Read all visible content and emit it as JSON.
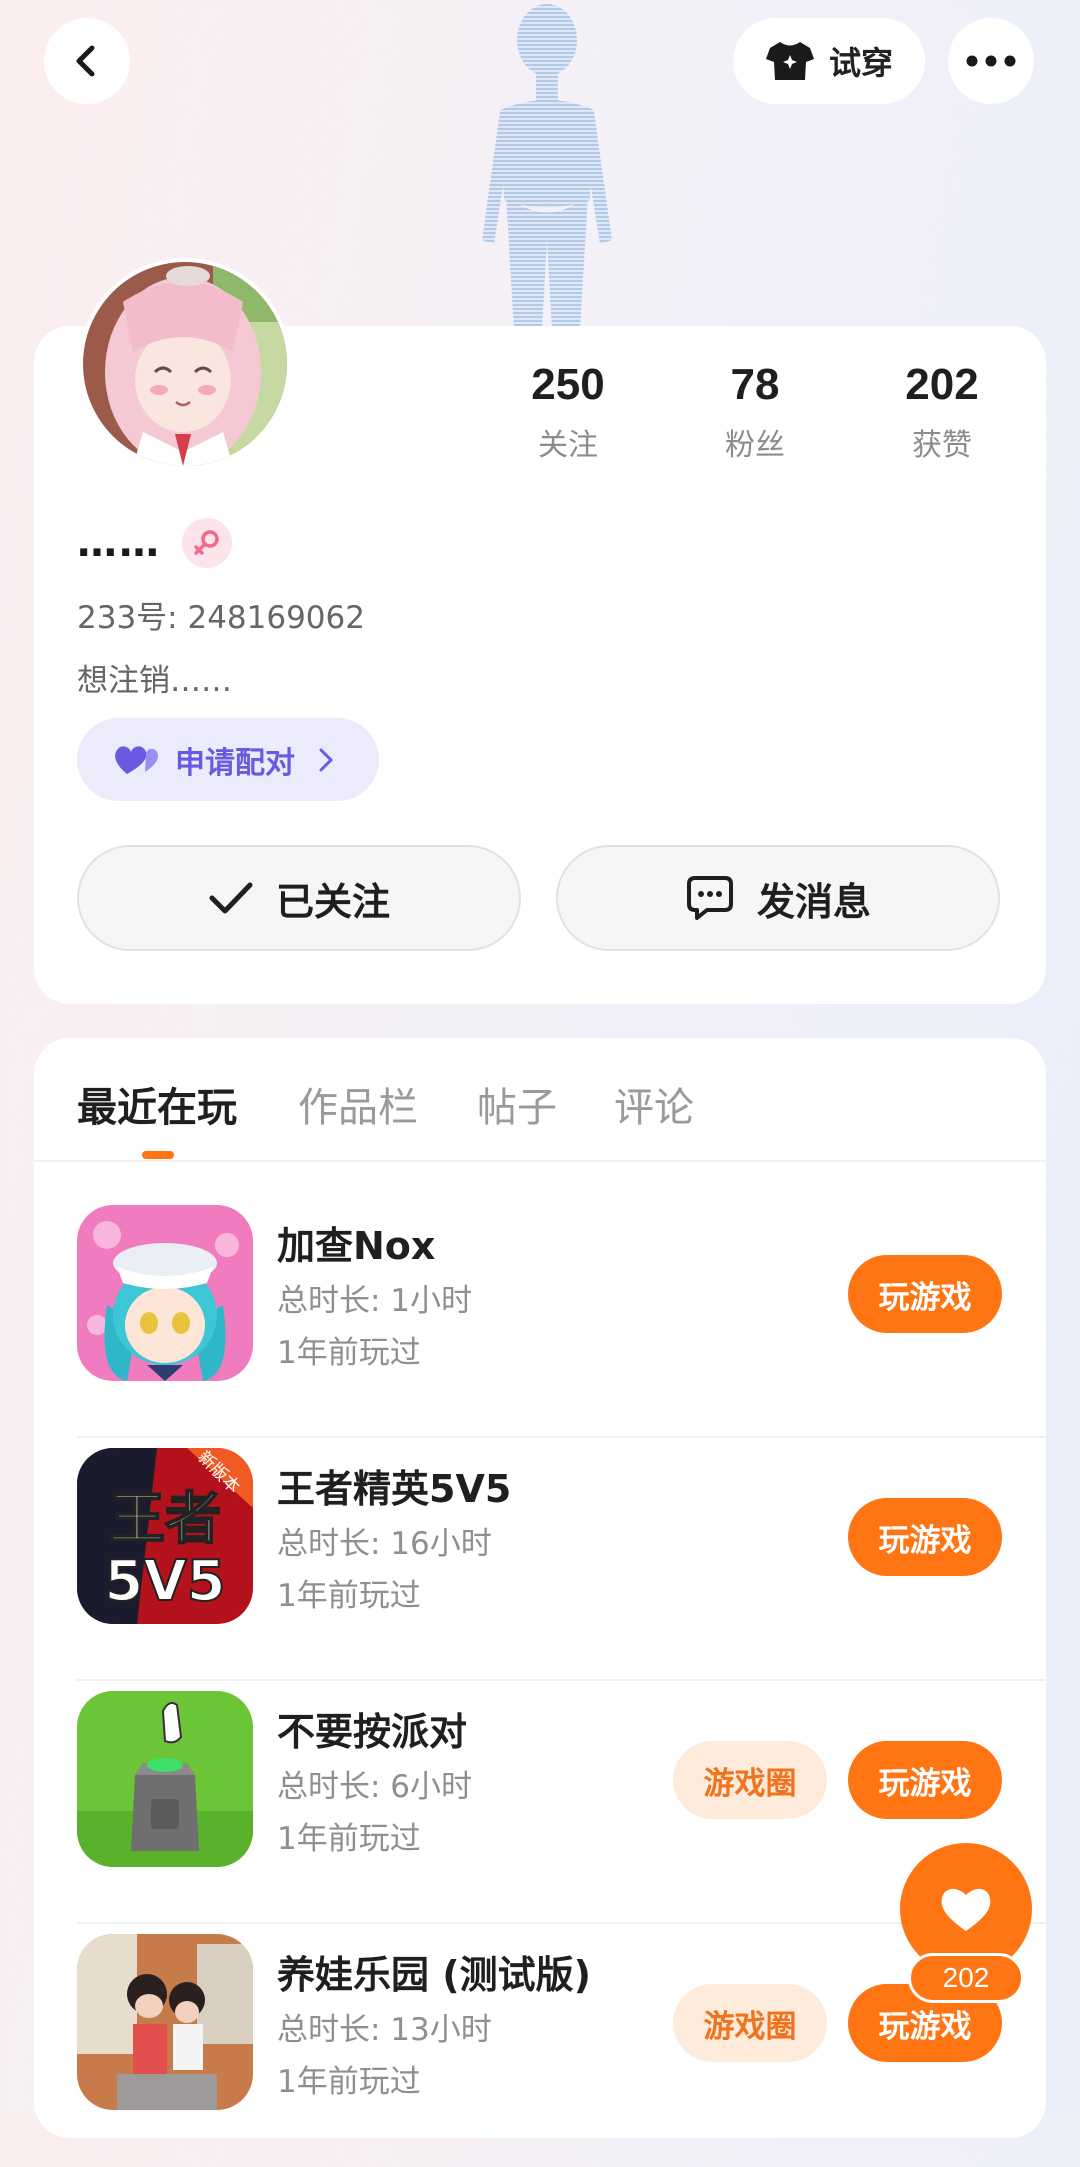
{
  "header": {
    "try_on_label": "试穿"
  },
  "profile": {
    "name": "……",
    "id_label": "233号: 248169062",
    "bio": "想注销……",
    "match_label": "申请配对",
    "stats": [
      {
        "value": "250",
        "label": "关注"
      },
      {
        "value": "78",
        "label": "粉丝"
      },
      {
        "value": "202",
        "label": "获赞"
      }
    ],
    "follow_label": "已关注",
    "message_label": "发消息"
  },
  "tabs": [
    "最近在玩",
    "作品栏",
    "帖子",
    "评论"
  ],
  "games": [
    {
      "name": "加查Nox",
      "duration": "总时长: 1小时",
      "last_played": "1年前玩过",
      "play_label": "玩游戏",
      "circle_label": ""
    },
    {
      "name": "王者精英5V5",
      "duration": "总时长: 16小时",
      "last_played": "1年前玩过",
      "play_label": "玩游戏",
      "circle_label": "",
      "icon_text_top": "王者",
      "icon_text_bottom": "5V5",
      "icon_ribbon": "新版本"
    },
    {
      "name": "不要按派对",
      "duration": "总时长: 6小时",
      "last_played": "1年前玩过",
      "play_label": "玩游戏",
      "circle_label": "游戏圈"
    },
    {
      "name": "养娃乐园 (测试版)",
      "duration": "总时长: 13小时",
      "last_played": "1年前玩过",
      "play_label": "玩游戏",
      "circle_label": "游戏圈"
    }
  ],
  "like_float": {
    "count": "202"
  },
  "colors": {
    "accent": "#ff7413",
    "match_bg": "#ecebfb",
    "match_text": "#6a5ae0"
  }
}
